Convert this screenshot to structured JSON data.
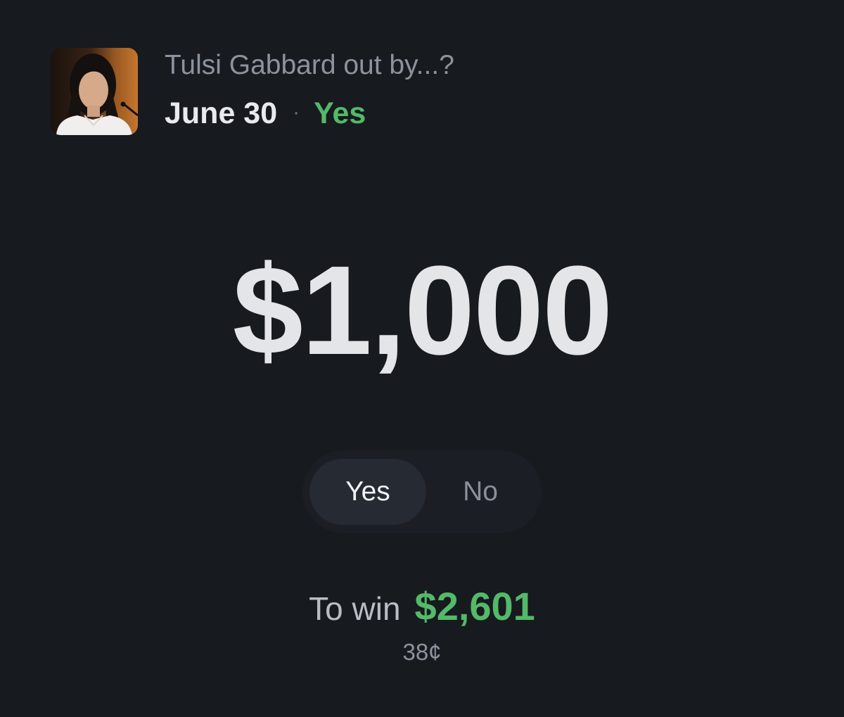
{
  "market": {
    "question": "Tulsi Gabbard out by...?",
    "date": "June 30",
    "separator": "·",
    "side": "Yes",
    "colors": {
      "positive": "#54b969",
      "background": "#171a1f"
    }
  },
  "order": {
    "amount": "$1,000"
  },
  "toggle": {
    "yes_label": "Yes",
    "no_label": "No",
    "selected": "Yes"
  },
  "payout": {
    "label": "To win",
    "value": "$2,601",
    "price": "38¢"
  }
}
